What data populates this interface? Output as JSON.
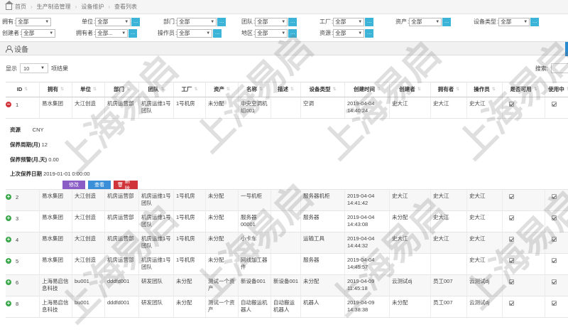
{
  "breadcrumb": [
    "首页",
    "生产制造管理",
    "设备维护",
    "查看列表"
  ],
  "filters": [
    {
      "label": "拥有",
      "value": "全部"
    },
    {
      "label": "单位",
      "value": "全部"
    },
    {
      "label": "部门",
      "value": "全部"
    },
    {
      "label": "团队",
      "value": "全部"
    },
    {
      "label": "工厂",
      "value": "全部"
    },
    {
      "label": "资产",
      "value": "全部"
    },
    {
      "label": "设备类型",
      "value": "全部"
    },
    {
      "label": "创建者",
      "value": "全部"
    },
    {
      "label": "拥有者",
      "value": "全部..."
    },
    {
      "label": "操作员",
      "value": "全部"
    },
    {
      "label": "地区",
      "value": "全部"
    },
    {
      "label": "资源",
      "value": "全部"
    }
  ],
  "panel": {
    "title": "设备"
  },
  "length": {
    "prefix": "显示",
    "value": "10",
    "suffix": "项结果"
  },
  "search": {
    "label": "搜索:"
  },
  "columns": [
    "ID",
    "拥有",
    "单位",
    "部门",
    "团队",
    "工厂",
    "资产",
    "名称",
    "描述",
    "设备类型",
    "创建时间",
    "创建者",
    "拥有者",
    "操作员",
    "是否可用",
    "使用中"
  ],
  "rows": [
    {
      "id": "1",
      "expanded": true,
      "owner": "易水集团",
      "unit": "大江创造",
      "dept": "机房运营部",
      "team": "机房运维1号团队",
      "factory": "1号机房",
      "asset": "未分配",
      "name": "中央空调机组001",
      "desc": "",
      "type": "空调",
      "created": "2019-04-04 14:40:24",
      "creator": "史大江",
      "holder": "史大江",
      "operator": "史大江"
    },
    {
      "id": "2",
      "expanded": false,
      "owner": "易水集团",
      "unit": "大江创造",
      "dept": "机房运营部",
      "team": "机房运维1号团队",
      "factory": "1号机房",
      "asset": "未分配",
      "name": "一号机柜",
      "desc": "",
      "type": "服务器机柜",
      "created": "2019-04-04 14:41:42",
      "creator": "史大江",
      "holder": "史大江",
      "operator": "史大江"
    },
    {
      "id": "3",
      "expanded": false,
      "owner": "易水集团",
      "unit": "大江创造",
      "dept": "机房运营部",
      "team": "机房运维1号团队",
      "factory": "1号机房",
      "asset": "未分配",
      "name": "服务器00001",
      "desc": "",
      "type": "服务器",
      "created": "2019-04-04 14:43:08",
      "creator": "未分配",
      "holder": "史大江",
      "operator": "史大江"
    },
    {
      "id": "4",
      "expanded": false,
      "owner": "易水集团",
      "unit": "大江创造",
      "dept": "机房运营部",
      "team": "机房运维1号团队",
      "factory": "1号机房",
      "asset": "未分配",
      "name": "小卡车",
      "desc": "",
      "type": "运输工具",
      "created": "2019-04-04 14:44:32",
      "creator": "史大江",
      "holder": "史大江",
      "operator": "史大江"
    },
    {
      "id": "5",
      "expanded": false,
      "owner": "易水集团",
      "unit": "大江创造",
      "dept": "机房运营部",
      "team": "机房运维1号团队",
      "factory": "1号机房",
      "asset": "未分配",
      "name": "网线加工器件",
      "desc": "",
      "type": "服务器",
      "created": "2019-04-04 14:45:57",
      "creator": "",
      "holder": "",
      "operator": "史大江"
    },
    {
      "id": "6",
      "expanded": false,
      "owner": "上海易启信息科技",
      "unit": "bu001",
      "dept": "dddfd001",
      "team": "研发团队",
      "factory": "未分配",
      "asset": "测试一个资产",
      "name": "新设备001",
      "desc": "新设备001",
      "type": "未分配",
      "created": "2019-04-09 11:45:18",
      "creator": "云测试dj",
      "holder": "员工007",
      "operator": "云测试dj"
    },
    {
      "id": "8",
      "expanded": false,
      "owner": "上海易启信息科技",
      "unit": "bu001",
      "dept": "dddfd001",
      "team": "研发团队",
      "factory": "未分配",
      "asset": "测试一个资产",
      "name": "自动搬运机器人",
      "desc": "自动搬运机器人",
      "type": "机器人",
      "created": "2019-04-09 14:38:38",
      "creator": "未分配",
      "holder": "员工007",
      "operator": "云测试dj"
    }
  ],
  "detail": {
    "resource_label": "资源",
    "resource_value": "CNY",
    "cycle_label": "保养周期(月)",
    "cycle_value": "12",
    "warn_label": "保养预警(月,天)",
    "warn_value": "0.00",
    "last_label": "上次保养日期",
    "last_value": "2019-01-01 0:00:00",
    "edit": "修改",
    "view": "查看",
    "delete": "删除"
  },
  "watermark": "上海易启"
}
